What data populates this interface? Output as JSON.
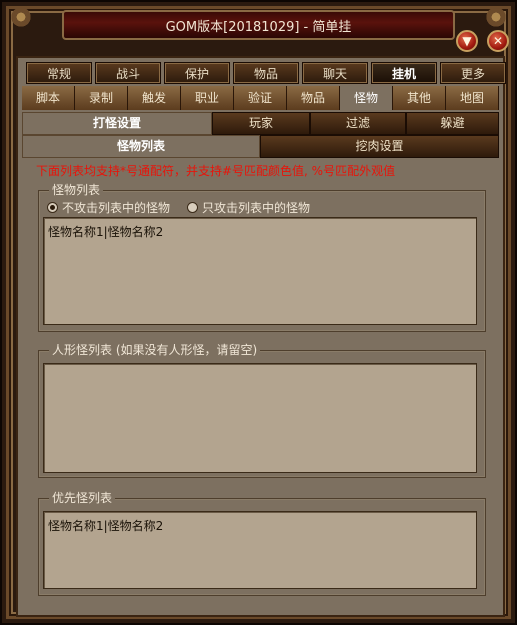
{
  "window": {
    "title": "GOM版本[20181029] - 简单挂",
    "min_icon": "chevron-down-icon",
    "close_icon": "close-icon"
  },
  "tabs_main": [
    {
      "label": "常规"
    },
    {
      "label": "战斗"
    },
    {
      "label": "保护"
    },
    {
      "label": "物品"
    },
    {
      "label": "聊天"
    },
    {
      "label": "挂机"
    },
    {
      "label": "更多"
    }
  ],
  "tabs_sub": [
    {
      "label": "脚本"
    },
    {
      "label": "录制"
    },
    {
      "label": "触发"
    },
    {
      "label": "职业"
    },
    {
      "label": "验证"
    },
    {
      "label": "物品"
    },
    {
      "label": "怪物"
    },
    {
      "label": "其他"
    },
    {
      "label": "地图"
    }
  ],
  "tabs_third_row1": [
    {
      "label": "打怪设置"
    },
    {
      "label": "玩家"
    },
    {
      "label": "过滤"
    },
    {
      "label": "躲避"
    }
  ],
  "tabs_third_row2": [
    {
      "label": "怪物列表"
    },
    {
      "label": "挖肉设置"
    }
  ],
  "notice": "下面列表均支持*号通配符，并支持#号匹配颜色值, %号匹配外观值",
  "monster_list": {
    "legend": "怪物列表",
    "radio_exclude": "不攻击列表中的怪物",
    "radio_only": "只攻击列表中的怪物",
    "value": "怪物名称1|怪物名称2"
  },
  "humanoid_list": {
    "legend": "人形怪列表 (如果没有人形怪，请留空)",
    "value": ""
  },
  "priority_list": {
    "legend": "优先怪列表",
    "value": "怪物名称1|怪物名称2"
  }
}
